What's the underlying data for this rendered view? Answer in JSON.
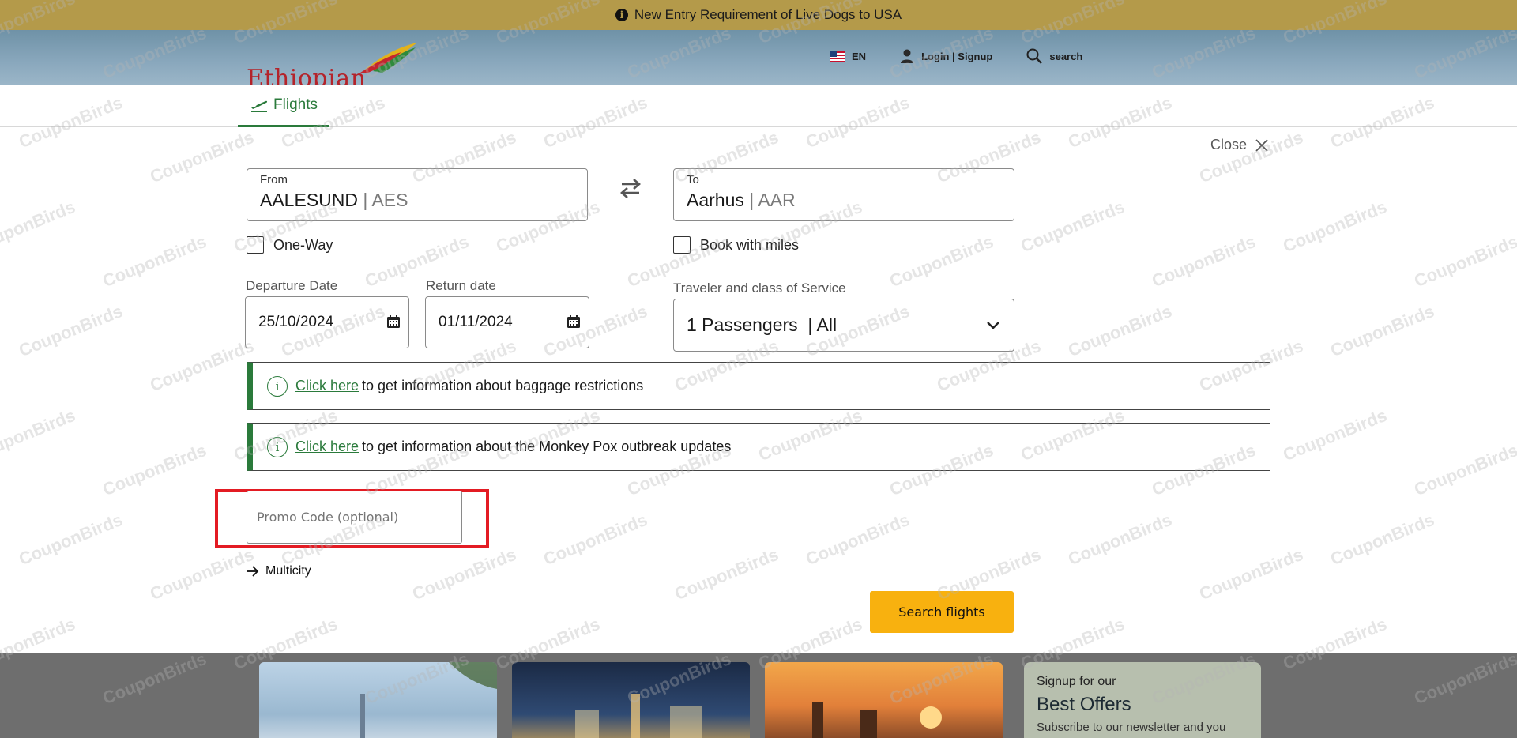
{
  "announcement": {
    "text": "New Entry Requirement of Live Dogs to USA",
    "icon": "info-icon"
  },
  "header": {
    "logo_text": "Ethiopian",
    "language": "EN",
    "login": "Login | Signup",
    "search": "search"
  },
  "tabs": [
    {
      "label": "Flights",
      "active": true
    }
  ],
  "booking": {
    "close_label": "Close",
    "from": {
      "label": "From",
      "city": "AALESUND",
      "code": "| AES"
    },
    "to": {
      "label": "To",
      "city": "Aarhus",
      "code": "| AAR"
    },
    "one_way_label": "One-Way",
    "book_with_miles_label": "Book with miles",
    "departure": {
      "label": "Departure Date",
      "value": "25/10/2024"
    },
    "return": {
      "label": "Return date",
      "value": "01/11/2024"
    },
    "traveler": {
      "label": "Traveler and class of Service",
      "value": "1 Passengers  | All"
    },
    "notices": [
      {
        "link": "Click here",
        "text": "to get information about baggage restrictions"
      },
      {
        "link": "Click here",
        "text": "to get information about the Monkey Pox outbreak updates"
      }
    ],
    "promo_placeholder": "Promo Code (optional)",
    "multicity_label": "Multicity",
    "search_button": "Search flights"
  },
  "footer": {
    "signup_small": "Signup for our",
    "signup_title": "Best Offers",
    "signup_text": "Subscribe to our newsletter and you"
  },
  "watermark": "CouponBirds",
  "colors": {
    "accent_green": "#2a7a3b",
    "search_yellow": "#f8b10f",
    "highlight_red": "#e31b23",
    "announcement_bg": "#b49a4a"
  }
}
